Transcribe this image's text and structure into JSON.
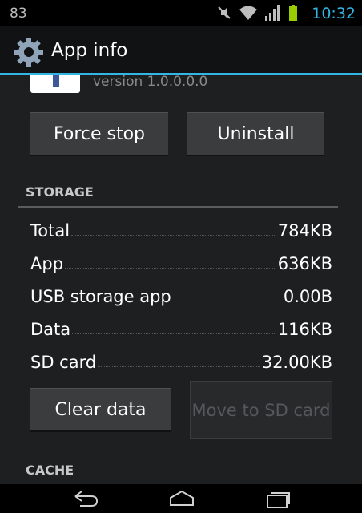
{
  "status_bar": {
    "notification_count": "83",
    "time": "10:32",
    "icons": [
      "mute-icon",
      "wifi-icon",
      "signal-icon",
      "battery-icon"
    ]
  },
  "action_bar": {
    "title": "App info",
    "icon": "settings-gear-icon"
  },
  "app_header": {
    "version": "version 1.0.0.0.0"
  },
  "buttons": {
    "force_stop": "Force stop",
    "uninstall": "Uninstall",
    "clear_data": "Clear data",
    "move_to_sd": "Move to SD card"
  },
  "storage": {
    "header": "STORAGE",
    "rows": [
      {
        "label": "Total",
        "value": "784KB"
      },
      {
        "label": "App",
        "value": "636KB"
      },
      {
        "label": "USB storage app",
        "value": "0.00B"
      },
      {
        "label": "Data",
        "value": "116KB"
      },
      {
        "label": "SD card",
        "value": "32.00KB"
      }
    ]
  },
  "cache": {
    "header": "CACHE"
  },
  "nav_bar": {
    "icons": [
      "back-icon",
      "home-icon",
      "recent-apps-icon"
    ]
  },
  "colors": {
    "accent": "#33b5e5",
    "background": "#1d1f21"
  }
}
